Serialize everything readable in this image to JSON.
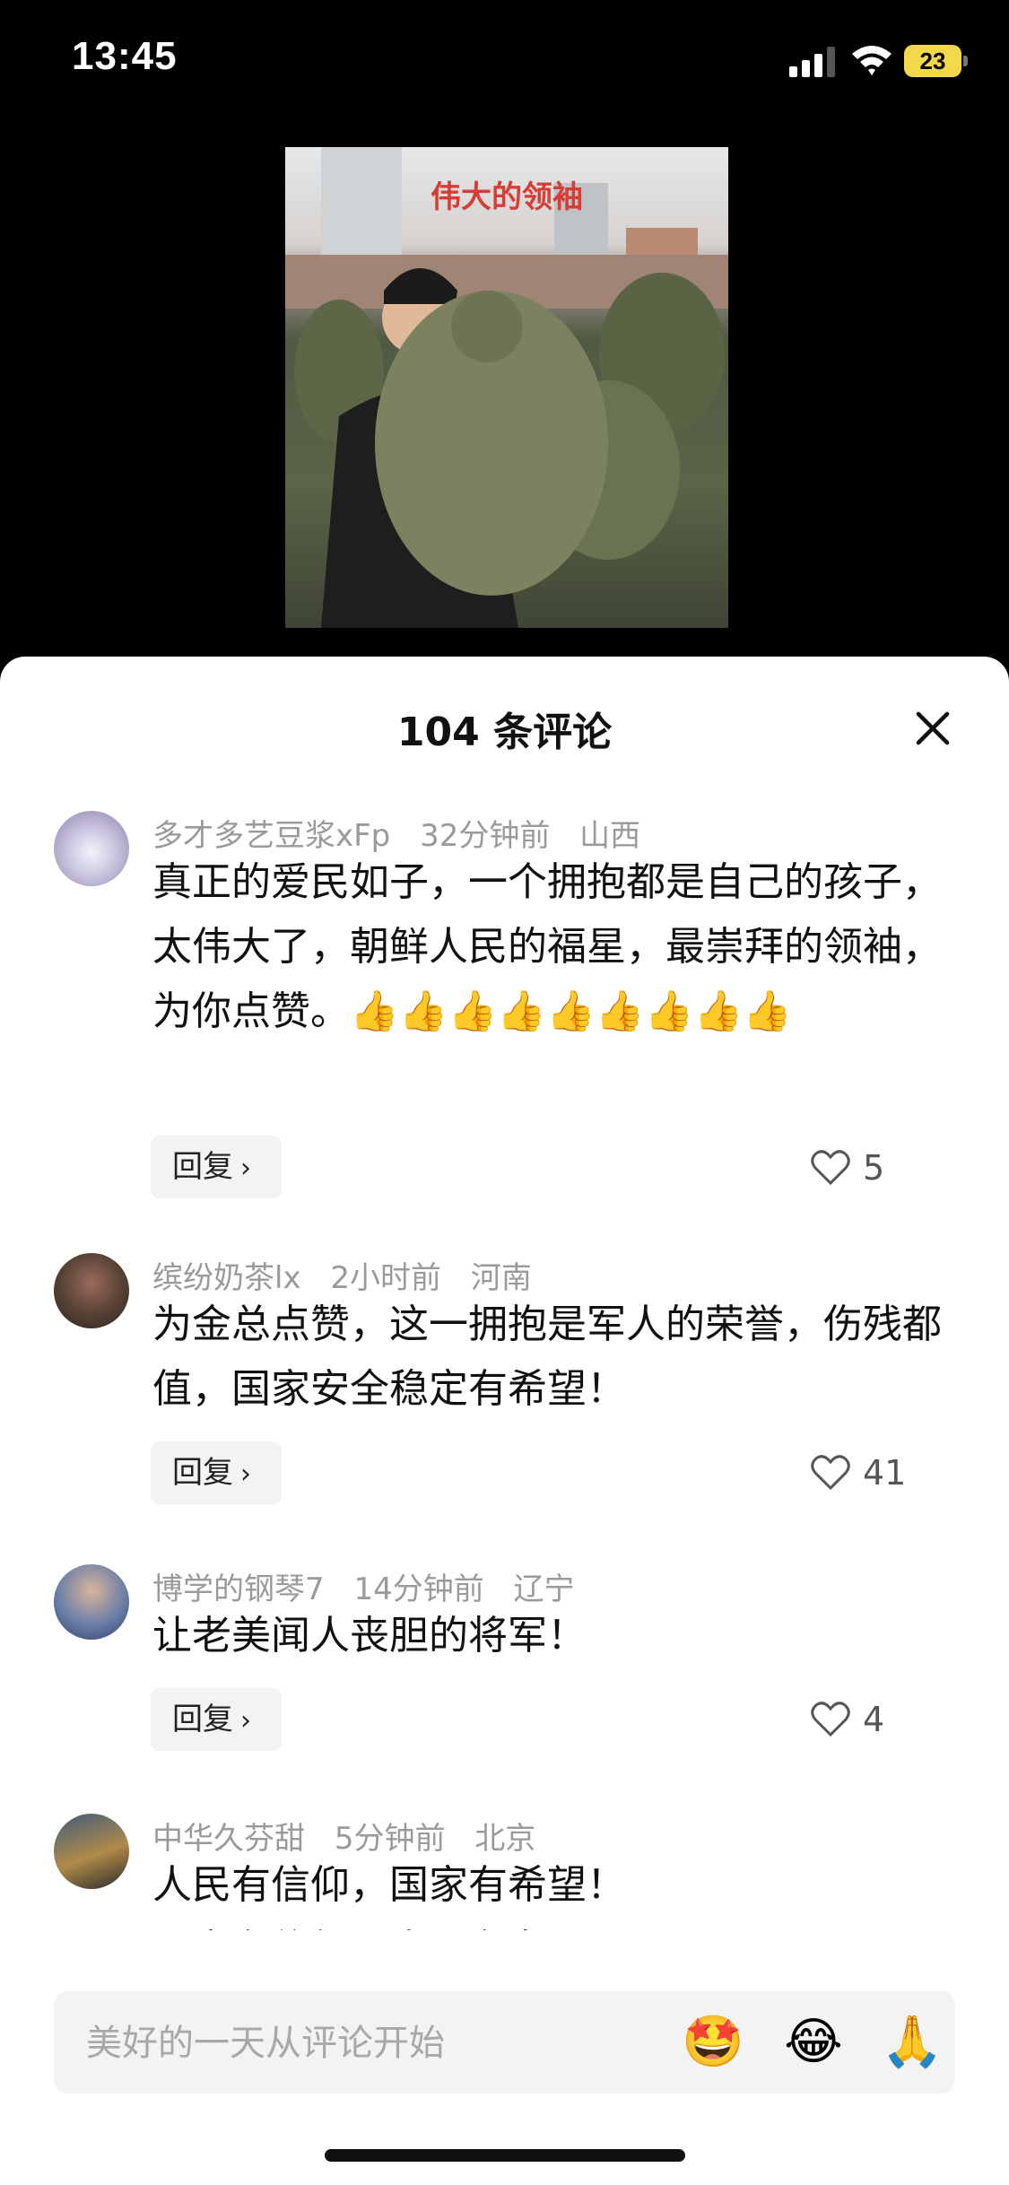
{
  "status": {
    "time": "13:45",
    "battery": "23"
  },
  "video": {
    "caption": "伟大的领袖"
  },
  "sheet": {
    "title": "104 条评论"
  },
  "comments": [
    {
      "user": "多才多艺豆浆xFp",
      "time": "32分钟前",
      "location": "山西",
      "text": "真正的爱民如子，一个拥抱都是自己的孩子，太伟大了，朝鲜人民的福星，最崇拜的领袖，为你点赞。",
      "emoji": "👍👍👍👍👍👍👍👍👍",
      "reply": "回复",
      "likes": "5"
    },
    {
      "user": "缤纷奶茶lx",
      "time": "2小时前",
      "location": "河南",
      "text": "为金总点赞，这一拥抱是军人的荣誉，伤残都值，国家安全稳定有希望！",
      "reply": "回复",
      "likes": "41"
    },
    {
      "user": "博学的钢琴7",
      "time": "14分钟前",
      "location": "辽宁",
      "text": "让老美闻人丧胆的将军！",
      "reply": "回复",
      "likes": "4"
    },
    {
      "user": "中华久芬甜",
      "time": "5分钟前",
      "location": "北京",
      "text": "人民有信仰，国家有希望！国家有信仰，人民有力量！"
    }
  ],
  "input": {
    "placeholder": "美好的一天从评论开始"
  },
  "emojis": [
    "🤩",
    "😂",
    "🙏"
  ],
  "icons": {
    "close": "close-icon",
    "like": "heart-icon",
    "reply_chevron": "chevron-right-icon"
  }
}
